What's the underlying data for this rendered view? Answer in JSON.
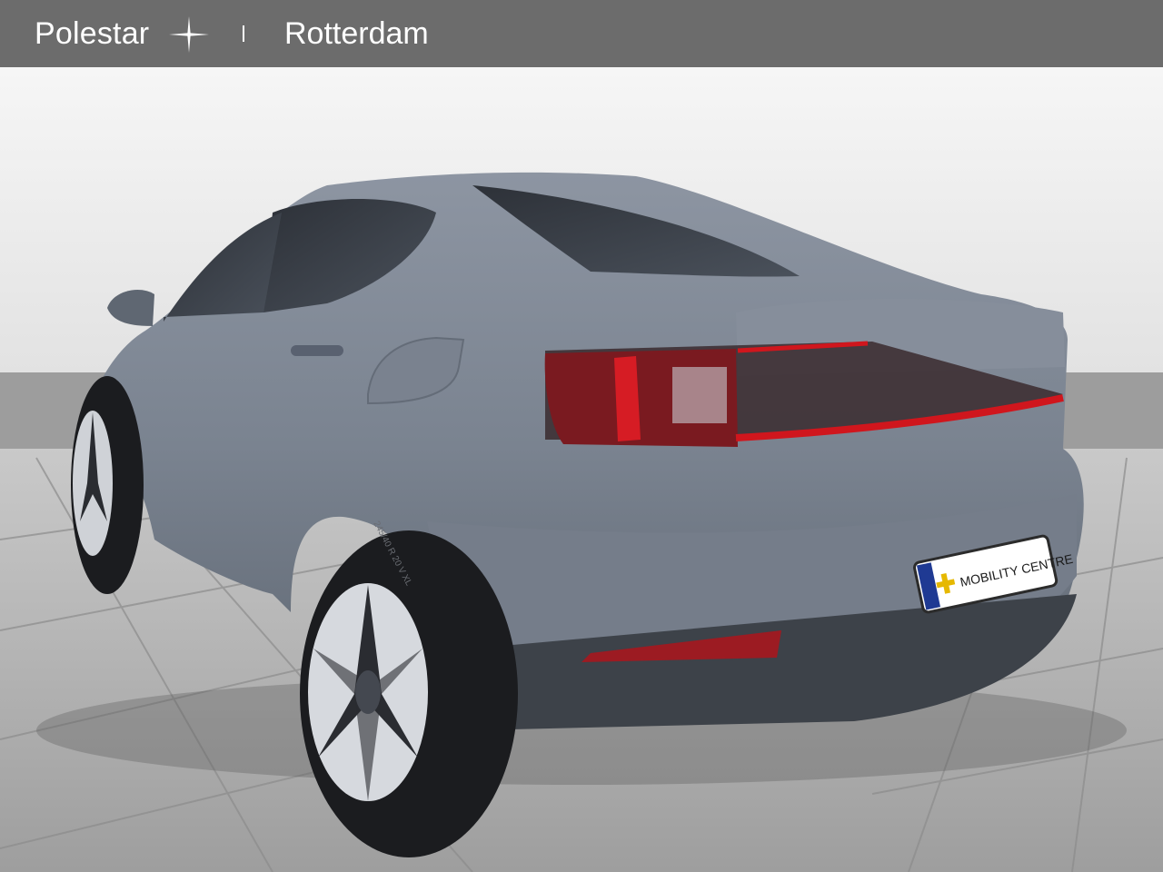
{
  "header": {
    "brand": "Polestar",
    "location": "Rotterdam",
    "logo_icon": "polestar-star-icon",
    "background": "#6c6c6c"
  },
  "photo": {
    "plate_text": "MOBILITY CENTRE",
    "tire_text": "245/40 R 20 V XL",
    "colors": {
      "wall": "#efefef",
      "wall_band": "#9a9a9a",
      "floor": "#b7b7b7",
      "car_body": "#7f8794",
      "taillight": "#c4151c"
    }
  }
}
